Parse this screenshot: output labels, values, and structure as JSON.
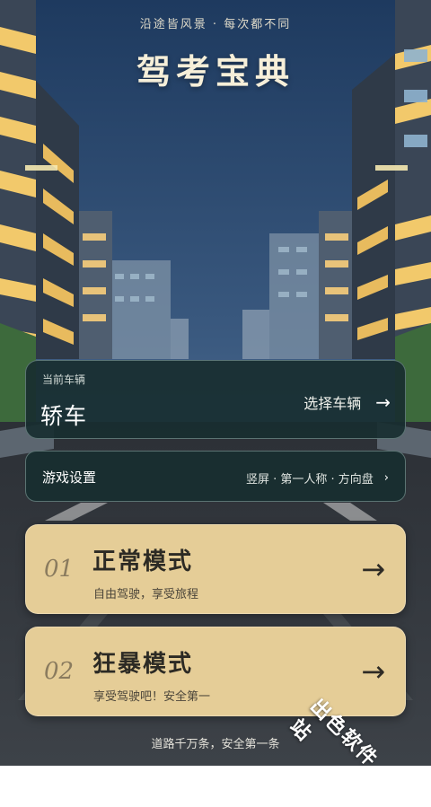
{
  "header": {
    "subtitle": "沿途皆风景 · 每次都不同",
    "title": "驾考宝典"
  },
  "vehicle": {
    "label": "当前车辆",
    "value": "轿车",
    "select_label": "选择车辆",
    "arrow_icon": "arrow-right-icon"
  },
  "settings": {
    "label": "游戏设置",
    "value": "竖屏 · 第一人称 · 方向盘",
    "chevron_icon": "chevron-right-icon"
  },
  "modes": [
    {
      "number": "01",
      "title": "正常模式",
      "description": "自由驾驶，享受旅程"
    },
    {
      "number": "02",
      "title": "狂暴模式",
      "description": "享受驾驶吧！安全第一"
    }
  ],
  "footer": {
    "text": "道路千万条，安全第一条"
  },
  "watermark": {
    "text": "出色软件站"
  },
  "colors": {
    "sky_top": "#1f3a5e",
    "sky_bottom": "#4f6e90",
    "card_dark": "#182e30",
    "card_gold": "#e5cd97",
    "window_yellow": "#f2c96b"
  }
}
